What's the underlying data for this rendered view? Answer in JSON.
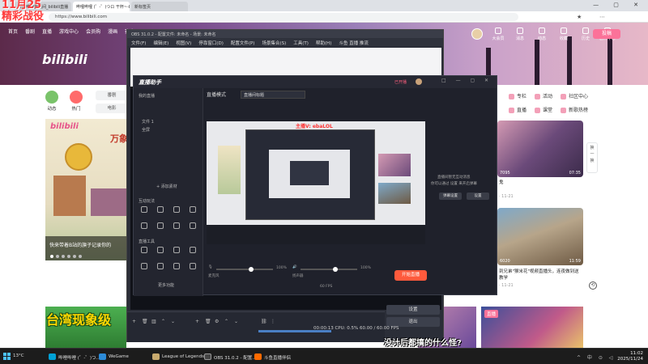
{
  "overlay": {
    "date": "11月25",
    "subtitle_left": "精彩战役"
  },
  "browser": {
    "tabs": [
      "哔哩哔哩直播间_bilibili直播",
      "哔哩哔哩 (゜-゜)つロ 干杯~-bilibili",
      "新标签页"
    ],
    "url": "https://www.bilibili.com"
  },
  "bili": {
    "nav": [
      "首页",
      "番剧",
      "直播",
      "游戏中心",
      "会员购",
      "漫画",
      "赛事"
    ],
    "logo": "bilibili",
    "right_nav": [
      "大会员",
      "消息",
      "动态",
      "收藏",
      "历史",
      "创作中心"
    ],
    "upload": "投稿",
    "left_icons": [
      {
        "label": "动态"
      },
      {
        "label": "热门"
      }
    ],
    "pills": [
      "番剧",
      "电影"
    ],
    "hero_caption": "快来带着B站的旗子记录你的",
    "hero_tag": "万象",
    "right_menu": [
      "专栏",
      "活动",
      "社区中心",
      "直播",
      "课堂",
      "新歌热榜"
    ],
    "float_side": [
      "换",
      "一",
      "换"
    ],
    "videos": [
      {
        "stat": "7095",
        "dur": "07:35",
        "title": "鬼",
        "meta": ""
      },
      {
        "stat": "6020",
        "dur": "11:59",
        "title": "到兄弟\"猴米花\"视频直播头，连夜做到送教学",
        "meta": "· 11-21"
      }
    ],
    "card_meta": "· 11-21",
    "bottom_thumb_text": "台湾现象级",
    "bottom_badge": "直播"
  },
  "obs": {
    "title": "OBS 31.0.2 - 配置文件: 未命名 - 场景: 未命名",
    "menu": [
      "文件(F)",
      "编辑(E)",
      "视图(V)",
      "停靠窗口(D)",
      "配置文件(P)",
      "场景集合(S)",
      "工具(T)",
      "帮助(H)",
      "斗鱼 直播 推流"
    ],
    "buttons": [
      "设置",
      "退出"
    ],
    "status": "00:00:13   CPU: 0.5%   60.00 / 60.00 FPS"
  },
  "live": {
    "logo": "直播助手",
    "status_label": "已开播",
    "top_info_left": "直播模式",
    "title_value": "直播间标题",
    "streamer_tag": "主播V: ebaLOL",
    "sidebar": {
      "header": "我的直播",
      "items": [
        "文件 1",
        "全屏"
      ],
      "section1": "互动玩法",
      "section2": "直播工具",
      "add_source": "+ 添加素材",
      "more": "更多功能"
    },
    "right_panel": {
      "notice": "直播间暂无互动消息",
      "hint": "你可以通过 设置 来开启弹幕",
      "btn1": "弹幕设置",
      "btn2": "设置"
    },
    "start_button": "开始直播",
    "bottom": {
      "mic_label": "麦克风",
      "mic_value": "100%",
      "speaker_label": "扬声器",
      "speaker_value": "100%",
      "fps": "60 FPS"
    }
  },
  "stream_subtitle": "没计后都搞的什么怪?",
  "taskbar": {
    "temp": "13°C",
    "items": [
      "哔哩哔哩 (゜-゜)つ...",
      "WeGame",
      "League of Legends",
      "OBS 31.0.2 - 配置...",
      "斗鱼直播伴侣"
    ],
    "time": "11:02",
    "date": "2025/11/24",
    "tray": "^ 中 ⊙ ◁"
  },
  "colors": {
    "accent": "#fb7299",
    "obs_bg": "#2b2e38",
    "live_bg": "#1f212b",
    "start": "#ff5a3c",
    "date": "#ff3b3b"
  }
}
